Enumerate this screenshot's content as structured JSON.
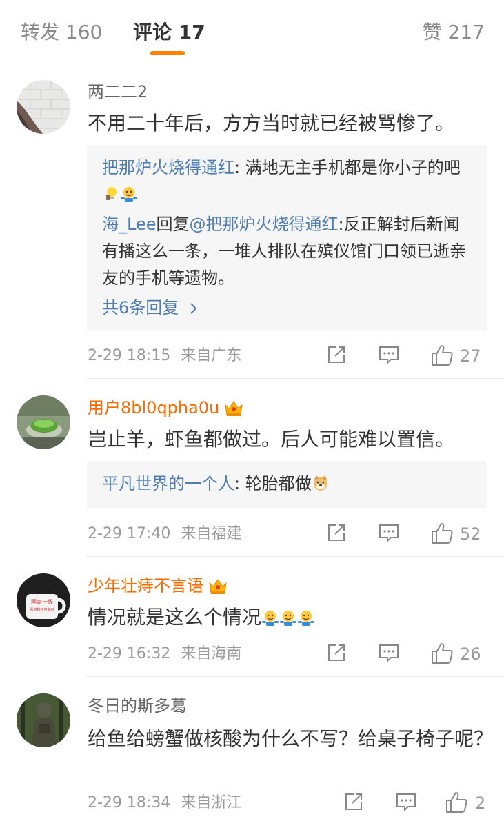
{
  "tabs": {
    "repost": "转发 160",
    "comment": "评论 17",
    "like": "赞 217"
  },
  "comments": [
    {
      "user": "两二二2",
      "text": "不用二十年后，方方当时就已经被骂惨了。",
      "replies": [
        {
          "user": "把那炉火烧得通红",
          "sep": ": ",
          "text": "满地无主手机都是你小子的吧"
        },
        {
          "user": "海_Lee",
          "mid": "回复",
          "mention": "@把那炉火烧得通红",
          "sep": ":",
          "text": "反正解封后新闻有播这么一条，一堆人排队在殡仪馆门口领已逝亲友的手机等遗物。"
        }
      ],
      "more": "共6条回复",
      "time": "2-29 18:15",
      "location": "来自广东",
      "likes": "27"
    },
    {
      "user": "用户8bl0qpha0u",
      "text": "岂止羊，虾鱼都做过。后人可能难以置信。",
      "replies": [
        {
          "user": "平凡世界的一个人",
          "sep": ": ",
          "text": "轮胎都做"
        }
      ],
      "time": "2-29 17:40",
      "location": "来自福建",
      "likes": "52"
    },
    {
      "user": "少年壮痔不言语",
      "text": "情况就是这么个情况",
      "avatar_text": [
        "国家一级",
        "喜欢狗狗自由者"
      ],
      "time": "2-29 16:32",
      "location": "来自海南",
      "likes": "26"
    },
    {
      "user": "冬日的斯多葛",
      "text": "给鱼给螃蟹做核酸为什么不写？给桌子椅子呢？",
      "time": "2-29 18:34",
      "location": "来自浙江",
      "likes": "2"
    }
  ],
  "colors": {
    "accent": "#ff8200",
    "link": "#4f7db3",
    "vip_name": "#ff6a00"
  },
  "icons": [
    "share-icon",
    "comment-icon",
    "like-icon",
    "crown-badge-icon",
    "shrug-emoji",
    "doge-emoji",
    "bulb-emoji",
    "chevron-right-icon"
  ]
}
